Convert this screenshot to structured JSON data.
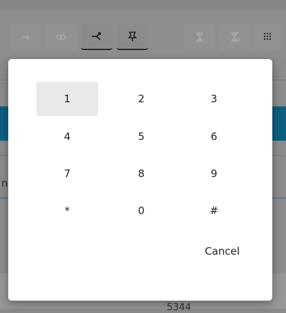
{
  "toolbar": {
    "buttons": [
      {
        "icon": "forward-arrow-icon"
      },
      {
        "icon": "voicemail-icon"
      },
      {
        "icon": "transfer-icon",
        "active": true
      },
      {
        "icon": "pin-icon",
        "active": true
      },
      {
        "icon": "hourglass-icon"
      },
      {
        "icon": "hourglass-arrow-icon"
      },
      {
        "icon": "dialpad-icon"
      }
    ]
  },
  "background": {
    "partial_letter": "n",
    "partial_number": "5344"
  },
  "dialpad": {
    "keys": [
      "1",
      "2",
      "3",
      "4",
      "5",
      "6",
      "7",
      "8",
      "9",
      "*",
      "0",
      "#"
    ],
    "focused_key": "1",
    "cancel_label": "Cancel"
  }
}
